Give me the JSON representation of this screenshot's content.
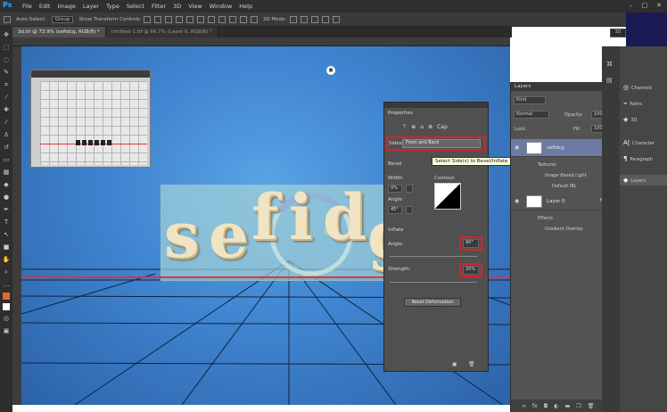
{
  "app_logo": "Ps",
  "menu": [
    "File",
    "Edit",
    "Image",
    "Layer",
    "Type",
    "Select",
    "Filter",
    "3D",
    "View",
    "Window",
    "Help"
  ],
  "window_controls": [
    "–",
    "□",
    "✕"
  ],
  "options_bar": {
    "auto_select": "Auto-Select:",
    "group": "Group",
    "show_transform": "Show Transform Controls",
    "mode_3d": "3D Mode:",
    "workspace_value": "3D"
  },
  "tabs": [
    {
      "label": "3d.tif @ 73.9% (sefidcg, RGB/8) *",
      "active": true
    },
    {
      "label": "Untitled-1.tif @ 66.7% (Layer 0, RGB/8) *",
      "active": false
    }
  ],
  "canvas": {
    "letters": [
      "s",
      "e",
      "f",
      "i",
      "d",
      "g"
    ]
  },
  "properties": {
    "title": "Properties",
    "cap_label": "Cap",
    "sides_label": "Sides:",
    "sides_value": "Front and Back",
    "tooltip": "Select Side(s) to Bevel/Inflate",
    "bevel_label": "Bevel",
    "width_label": "Width:",
    "width_value": "0%",
    "contour_label": "Contour:",
    "angle_label_bevel": "Angle:",
    "angle_value_bevel": "45°",
    "inflate_label": "Inflate",
    "angle_label": "Angle:",
    "angle_value": "90°",
    "strength_label": "Strength:",
    "strength_value": "20%",
    "reset_button": "Reset Deformation"
  },
  "layers": {
    "title": "Layers",
    "filter_kind": "Kind",
    "blend_mode": "Normal",
    "opacity_label": "Opacity:",
    "opacity_value": "100%",
    "lock_label": "Lock:",
    "fill_label": "Fill:",
    "fill_value": "100%",
    "items": [
      {
        "name": "sefidcg",
        "selected": true
      },
      {
        "name": "Layer 0",
        "selected": false
      }
    ],
    "textures_label": "Textures",
    "image_based_light": "Image Based Light",
    "default_ibl": "Default IBL",
    "effects_label": "Effects",
    "gradient_overlay": "Gradient Overlay"
  },
  "dock": [
    {
      "icon": "channels-icon",
      "label": "Channels"
    },
    {
      "icon": "paths-icon",
      "label": "Paths"
    },
    {
      "icon": "3d-icon",
      "label": "3D"
    },
    {
      "icon": "character-icon",
      "label": "Character"
    },
    {
      "icon": "paragraph-icon",
      "label": "Paragraph"
    },
    {
      "icon": "layers-icon",
      "label": "Layers"
    }
  ],
  "colors": {
    "highlight_red": "#d9202a",
    "canvas_blue": "#3f84cf",
    "selected_layer": "#6c7ba3"
  }
}
